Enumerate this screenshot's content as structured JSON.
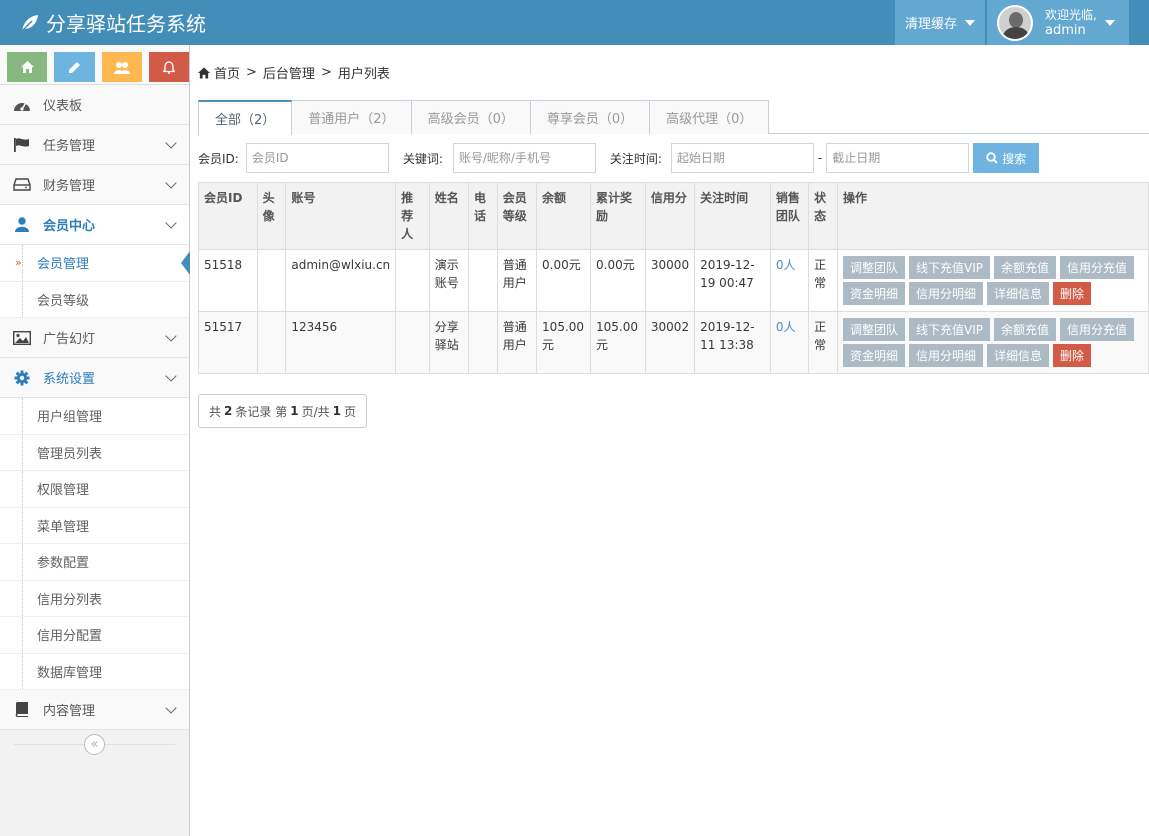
{
  "app": {
    "title": "分享驿站任务系统"
  },
  "navbar": {
    "clear_cache": "清理缓存",
    "welcome": "欢迎光临,",
    "username": "admin"
  },
  "sidebar": {
    "shortcut_icons": [
      "home-icon",
      "pencil-icon",
      "users-icon",
      "bell-icon"
    ],
    "items": [
      {
        "label": "仪表板",
        "icon": "dashboard-icon",
        "expandable": false
      },
      {
        "label": "任务管理",
        "icon": "flag-icon",
        "expandable": true
      },
      {
        "label": "财务管理",
        "icon": "hdd-icon",
        "expandable": true
      },
      {
        "label": "会员中心",
        "icon": "user-icon",
        "expandable": true,
        "active": true,
        "children": [
          {
            "label": "会员管理",
            "current": true
          },
          {
            "label": "会员等级"
          }
        ]
      },
      {
        "label": "广告幻灯",
        "icon": "picture-icon",
        "expandable": true
      },
      {
        "label": "系统设置",
        "icon": "cog-icon",
        "expandable": true,
        "children": [
          {
            "label": "用户组管理"
          },
          {
            "label": "管理员列表"
          },
          {
            "label": "权限管理"
          },
          {
            "label": "菜单管理"
          },
          {
            "label": "参数配置"
          },
          {
            "label": "信用分列表"
          },
          {
            "label": "信用分配置"
          },
          {
            "label": "数据库管理"
          }
        ]
      },
      {
        "label": "内容管理",
        "icon": "book-icon",
        "expandable": true
      }
    ]
  },
  "breadcrumb": {
    "home": "首页",
    "items": [
      "后台管理",
      "用户列表"
    ],
    "separator": ">"
  },
  "tabs": [
    {
      "label": "全部（2）",
      "active": true
    },
    {
      "label": "普通用户（2）"
    },
    {
      "label": "高级会员（0）"
    },
    {
      "label": "尊享会员（0）"
    },
    {
      "label": "高级代理（0）"
    }
  ],
  "filters": {
    "member_id_label": "会员ID:",
    "member_id_placeholder": "会员ID",
    "keyword_label": "关键词:",
    "keyword_placeholder": "账号/昵称/手机号",
    "time_label": "关注时间:",
    "start_placeholder": "起始日期",
    "dash": "-",
    "end_placeholder": "截止日期",
    "search_label": "搜索"
  },
  "table": {
    "headers": [
      "会员ID",
      "头像",
      "账号",
      "推荐人",
      "姓名",
      "电话",
      "会员等级",
      "余额",
      "累计奖励",
      "信用分",
      "关注时间",
      "销售团队",
      "状态",
      "操作"
    ],
    "rows": [
      {
        "id": "51518",
        "avatar": "",
        "account": "admin@wlxiu.cn",
        "referrer": "",
        "name": "演示账号",
        "phone": "",
        "level": "普通用户",
        "balance": "0.00元",
        "reward": "0.00元",
        "credit": "30000",
        "time": "2019-12-19 00:47",
        "team": "0人",
        "status": "正常"
      },
      {
        "id": "51517",
        "avatar": "",
        "account": "123456",
        "referrer": "",
        "name": "分享驿站",
        "phone": "",
        "level": "普通用户",
        "balance": "105.00元",
        "reward": "105.00元",
        "credit": "30002",
        "time": "2019-12-11 13:38",
        "team": "0人",
        "status": "正常"
      }
    ],
    "actions": [
      "调整团队",
      "线下充值VIP",
      "余额充值",
      "信用分充值",
      "资金明细",
      "信用分明细",
      "详细信息",
      "删除"
    ]
  },
  "pager": {
    "prefix": "共",
    "total": "2",
    "mid1": "条记录 第",
    "page": "1",
    "mid2": "页/共",
    "pages": "1",
    "suffix": "页"
  },
  "colors": {
    "navbar": "#438eb9",
    "accent": "#62a8d1",
    "action_button": "#abbac3",
    "danger": "#d15b47"
  }
}
